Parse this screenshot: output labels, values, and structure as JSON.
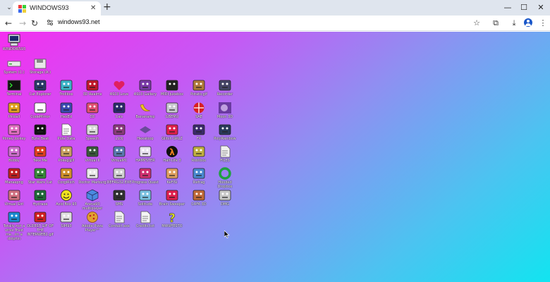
{
  "browser": {
    "tab_title": "WINDOWS93",
    "url": "windows93.net",
    "tab_menu_icon": "chevron-down-icon",
    "new_tab_icon": "plus-icon",
    "close_tab_icon": "close-icon",
    "window_controls": [
      "minimize-icon",
      "maximize-icon",
      "close-icon"
    ]
  },
  "desktop": {
    "gradient_colors": [
      "#f42ff0",
      "#c658f4",
      "#8f8ff2",
      "#4cc3f1",
      "#12e4f0"
    ],
    "icons": [
      {
        "label": "WINDOWS93",
        "icon": "computer-icon",
        "color": "#dfe3ea"
      },
      {
        "label": "System (C:)",
        "icon": "drive-icon",
        "color": "#e8e8e8"
      },
      {
        "label": "Storage (A:)",
        "icon": "floppy-icon",
        "color": "#e8e8e8"
      },
      {
        "label": "Terminal",
        "icon": "terminal-icon",
        "color": "#111111"
      },
      {
        "label": "Cat Explorer",
        "icon": "cat-icon",
        "color": "#2a3a6a"
      },
      {
        "label": "Trollbox",
        "icon": "chat-icon",
        "color": "#3cb4c8"
      },
      {
        "label": "3D Realms",
        "icon": "skull-icon",
        "color": "#c0182a"
      },
      {
        "label": "ASCII Love",
        "icon": "heart-icon",
        "color": "#e02060"
      },
      {
        "label": "ASCII Gallery",
        "icon": "numbers-icon",
        "color": "#7a3aa8"
      },
      {
        "label": "MIDI Jukebox",
        "icon": "piano-icon",
        "color": "#222222"
      },
      {
        "label": "Potato.gif",
        "icon": "potato-icon",
        "color": "#b07a3a"
      },
      {
        "label": "Recorder",
        "icon": "microphone-icon",
        "color": "#444466"
      },
      {
        "label": "Pinball",
        "icon": "pinball-icon",
        "color": "#e0a020"
      },
      {
        "label": "CodeMirror",
        "icon": "code-icon",
        "color": "#ffffff"
      },
      {
        "label": "HexEd",
        "icon": "hex-icon",
        "color": "#3a4ab0"
      },
      {
        "label": "3D",
        "icon": "teapot-icon",
        "color": "#e05070"
      },
      {
        "label": "Calc",
        "icon": "calculator-icon",
        "color": "#2a2a6a"
      },
      {
        "label": "Bananamp",
        "icon": "banana-icon",
        "color": "#f0c020"
      },
      {
        "label": "GBEMU",
        "icon": "gameboy-icon",
        "color": "#c8c8d0"
      },
      {
        "label": "SAE",
        "icon": "ball-icon",
        "color": "#d82020"
      },
      {
        "label": "Moon 3D",
        "icon": "moon-icon",
        "color": "#6a3aa0"
      },
      {
        "label": "Poney Jockey",
        "icon": "pony-icon",
        "color": "#e070c0"
      },
      {
        "label": "Byte Beat",
        "icon": "wave-icon",
        "color": "#101010"
      },
      {
        "label": "Pute Data",
        "icon": "document-icon",
        "color": "#ffffff"
      },
      {
        "label": "Speech",
        "icon": "speech-icon",
        "color": "#d8d8d8"
      },
      {
        "label": "LSDJ",
        "icon": "bottle-icon",
        "color": "#8a3a7a"
      },
      {
        "label": "Hexaloop",
        "icon": "diamond-icon",
        "color": "#6a4a9a"
      },
      {
        "label": "Glitch GRLZ",
        "icon": "lips-icon",
        "color": "#e0204a"
      },
      {
        "label": "FX",
        "icon": "flower-icon",
        "color": "#3a2a6a"
      },
      {
        "label": "PolyRainbow",
        "icon": "pattern-icon",
        "color": "#2a3a5a"
      },
      {
        "label": "Bobby",
        "icon": "bunny-icon",
        "color": "#d070d0"
      },
      {
        "label": "Take Me",
        "icon": "clown-icon",
        "color": "#e04020"
      },
      {
        "label": "Pokeg@ll",
        "icon": "egg-icon",
        "color": "#c8a060"
      },
      {
        "label": "Virtual II",
        "icon": "monitor-icon",
        "color": "#3a5a3a"
      },
      {
        "label": "VirtualPC",
        "icon": "pc-icon",
        "color": "#5a7ab0"
      },
      {
        "label": "HAMPSTER",
        "icon": "hamster-icon",
        "color": "#e8e0f0"
      },
      {
        "label": "Half-Life 3",
        "icon": "lambda-icon",
        "color": "#f08020"
      },
      {
        "label": "Robtbox",
        "icon": "robot-icon",
        "color": "#c0b040"
      },
      {
        "label": "FILES",
        "icon": "files-icon",
        "color": "#f0f0f0"
      },
      {
        "label": "Manaspng",
        "icon": "cat-face-icon",
        "color": "#c02020"
      },
      {
        "label": "Star Wars Cat",
        "icon": "yoda-icon",
        "color": "#3a8a3a"
      },
      {
        "label": "CorgiRich",
        "icon": "corgi-icon",
        "color": "#d0902a"
      },
      {
        "label": "Doctor Marburg",
        "icon": "doctor-icon",
        "color": "#e8e8e8"
      },
      {
        "label": "DEFRG32.EXE",
        "icon": "disk-icon",
        "color": "#d0d0d0"
      },
      {
        "label": "Progress Quest",
        "icon": "crab-icon",
        "color": "#d03070"
      },
      {
        "label": "KeFISi",
        "icon": "face-icon",
        "color": "#e0a060"
      },
      {
        "label": "Defrag",
        "icon": "defrag-icon",
        "color": "#4a8ad0"
      },
      {
        "label": "Hooded Dropbox",
        "icon": "ring-icon",
        "color": "#20a040"
      },
      {
        "label": "Virtual Girl",
        "icon": "girl-icon",
        "color": "#d07080"
      },
      {
        "label": "Hydraxe",
        "icon": "hydra-icon",
        "color": "#206a3a"
      },
      {
        "label": "Acid Box 93",
        "icon": "smiley-icon",
        "color": "#f0e020"
      },
      {
        "label": "Arena93 multiplayer",
        "icon": "cube-icon",
        "color": "#4a8ae0"
      },
      {
        "label": "SMS",
        "icon": "phone-icon",
        "color": "#303030"
      },
      {
        "label": "Solitude",
        "icon": "bottle-icon",
        "color": "#7ac0e0"
      },
      {
        "label": "Brain Sweeper",
        "icon": "brain-icon",
        "color": "#e02050"
      },
      {
        "label": "CAFA 3D",
        "icon": "face-icon",
        "color": "#c06a3a"
      },
      {
        "label": "DMG",
        "icon": "gun-icon",
        "color": "#c8c8c8"
      },
      {
        "label": "Totally not a virus.Trust me...im a dolphin",
        "icon": "dolphin-icon",
        "color": "#1a8ad0"
      },
      {
        "label": "OLDEST GIF OF THE INTERWEB2.gif",
        "icon": "gif-icon",
        "color": "#d02020"
      },
      {
        "label": "SIM93",
        "icon": "sim-icon",
        "color": "#e0e0e0"
      },
      {
        "label": "Adobe Pizza Player™",
        "icon": "pizza-icon",
        "color": "#e0a030"
      },
      {
        "label": "Contact.exe",
        "icon": "contact-icon",
        "color": "#f0f0f0"
      },
      {
        "label": "Credits.txt",
        "icon": "text-file-icon",
        "color": "#f4f4f4"
      },
      {
        "label": "MANIFESTO",
        "icon": "question-icon",
        "color": "#e0e020"
      }
    ]
  }
}
